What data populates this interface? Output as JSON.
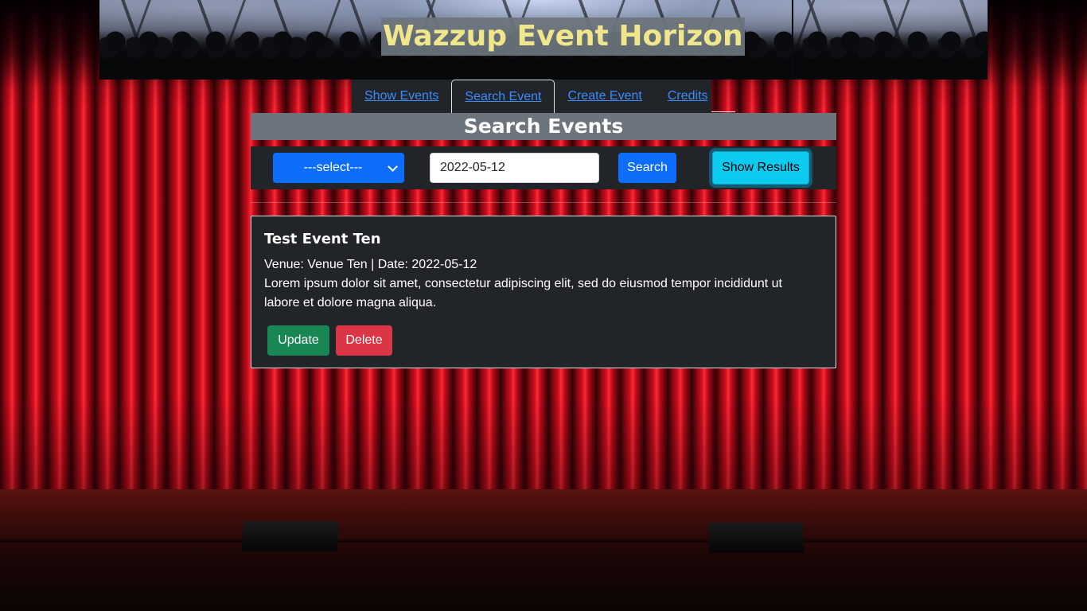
{
  "header": {
    "title": "Wazzup Event Horizon"
  },
  "nav": {
    "tabs": [
      {
        "label": "Show Events",
        "active": false
      },
      {
        "label": "Search Event",
        "active": true
      },
      {
        "label": "Create Event",
        "active": false
      },
      {
        "label": "Credits",
        "active": false
      }
    ]
  },
  "search": {
    "heading": "Search Events",
    "select_value": "---select---",
    "date_value": "2022-05-12",
    "search_label": "Search",
    "show_results_label": "Show Results"
  },
  "event": {
    "title": "Test Event Ten",
    "venue_label": "Venue:",
    "venue": "Venue Ten",
    "separator": "|",
    "date_label": "Date:",
    "date": "2022-05-12",
    "description": "Lorem ipsum dolor sit amet, consectetur adipiscing elit, sed do eiusmod tempor incididunt ut labore et dolore magna aliqua.",
    "update_label": "Update",
    "delete_label": "Delete"
  },
  "colors": {
    "primary": "#0d6efd",
    "info": "#0dcaf0",
    "success": "#198754",
    "danger": "#dc3545",
    "dark": "#212529",
    "secondary": "#6c757d",
    "title_text": "#f0e68c"
  }
}
